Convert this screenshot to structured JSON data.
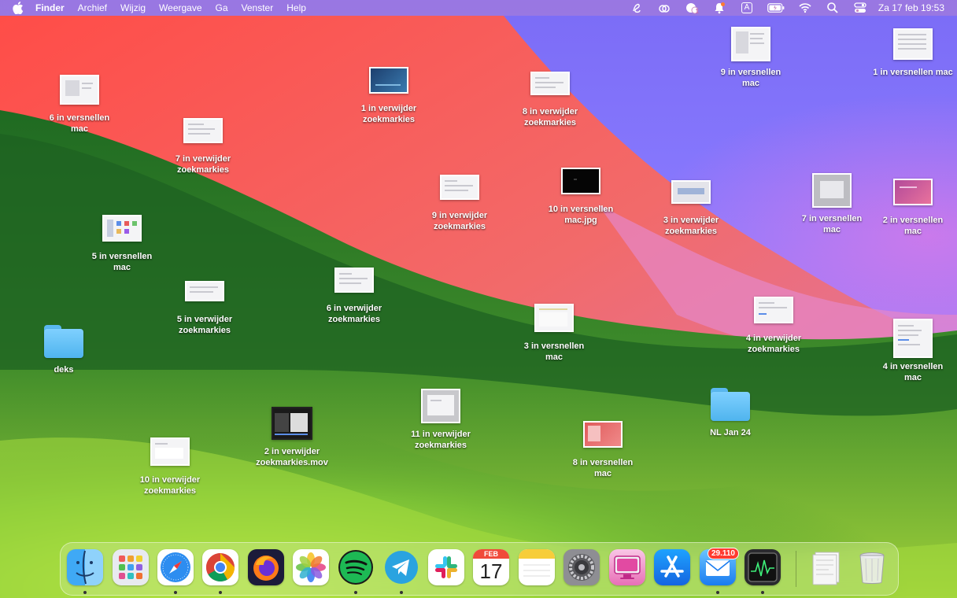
{
  "menubar": {
    "app_name": "Finder",
    "menus": [
      "Archief",
      "Wijzig",
      "Weergave",
      "Ga",
      "Venster",
      "Help"
    ],
    "clock": "Za 17 feb  19:53",
    "status_icons": [
      "script-icon",
      "creative-cloud-icon",
      "notification-center-icon",
      "bell-icon",
      "input-source-icon",
      "battery-icon",
      "wifi-icon",
      "spotlight-icon",
      "control-center-icon"
    ],
    "input_source_letter": "A",
    "notification_count": "1"
  },
  "desktop": {
    "items": [
      {
        "name": "6 in versnellen\nmac",
        "kind": "doc"
      },
      {
        "name": "7 in verwijder\nzoekmarkies",
        "kind": "doc"
      },
      {
        "name": "1 in verwijder\nzoekmarkies",
        "kind": "blue"
      },
      {
        "name": "8 in verwijder\nzoekmarkies",
        "kind": "doc"
      },
      {
        "name": "9 in versnellen\nmac",
        "kind": "doc"
      },
      {
        "name": "1 in versnellen mac",
        "kind": "doc"
      },
      {
        "name": "9 in verwijder\nzoekmarkies",
        "kind": "doc"
      },
      {
        "name": "10 in versnellen\nmac.jpg",
        "kind": "dark"
      },
      {
        "name": "3 in verwijder\nzoekmarkies",
        "kind": "gray"
      },
      {
        "name": "7 in versnellen\nmac",
        "kind": "gray"
      },
      {
        "name": "2 in versnellen\nmac",
        "kind": "purple"
      },
      {
        "name": "5 in versnellen\nmac",
        "kind": "doc"
      },
      {
        "name": "5 in verwijder\nzoekmarkies",
        "kind": "doc"
      },
      {
        "name": "6 in verwijder\nzoekmarkies",
        "kind": "doc"
      },
      {
        "name": "3 in versnellen\nmac",
        "kind": "doc"
      },
      {
        "name": "4 in verwijder\nzoekmarkies",
        "kind": "doc"
      },
      {
        "name": "4 in versnellen\nmac",
        "kind": "doc"
      },
      {
        "name": "deks",
        "kind": "folder"
      },
      {
        "name": "2 in verwijder\nzoekmarkies.mov",
        "kind": "dark"
      },
      {
        "name": "11 in verwijder\nzoekmarkies",
        "kind": "gray"
      },
      {
        "name": "NL Jan 24",
        "kind": "folder"
      },
      {
        "name": "8 in versnellen\nmac",
        "kind": "red"
      },
      {
        "name": "10 in verwijder\nzoekmarkies",
        "kind": "doc"
      }
    ]
  },
  "dock": {
    "apps": [
      {
        "name": "finder-icon",
        "running": true
      },
      {
        "name": "launchpad-icon",
        "running": false
      },
      {
        "name": "safari-icon",
        "running": true
      },
      {
        "name": "chrome-icon",
        "running": true
      },
      {
        "name": "firefox-icon",
        "running": false
      },
      {
        "name": "photos-icon",
        "running": false
      },
      {
        "name": "spotify-icon",
        "running": true
      },
      {
        "name": "telegram-icon",
        "running": true
      },
      {
        "name": "slack-icon",
        "running": false
      },
      {
        "name": "calendar-icon",
        "running": false
      },
      {
        "name": "notes-icon",
        "running": false
      },
      {
        "name": "system-settings-icon",
        "running": false
      },
      {
        "name": "cleanmymac-icon",
        "running": false
      },
      {
        "name": "app-store-icon",
        "running": false
      },
      {
        "name": "mail-icon",
        "running": true
      },
      {
        "name": "activity-monitor-icon",
        "running": true
      }
    ],
    "calendar_month": "FEB",
    "calendar_day": "17",
    "mail_badge": "29.110",
    "stack_icon": "downloads-stack-icon",
    "trash_icon": "trash-icon"
  },
  "colors": {
    "wallpaper_green": "#3d8a2a",
    "wallpaper_red": "#f25a55",
    "wallpaper_purple": "#7d6cf4",
    "badge_red": "#ff3b30"
  }
}
